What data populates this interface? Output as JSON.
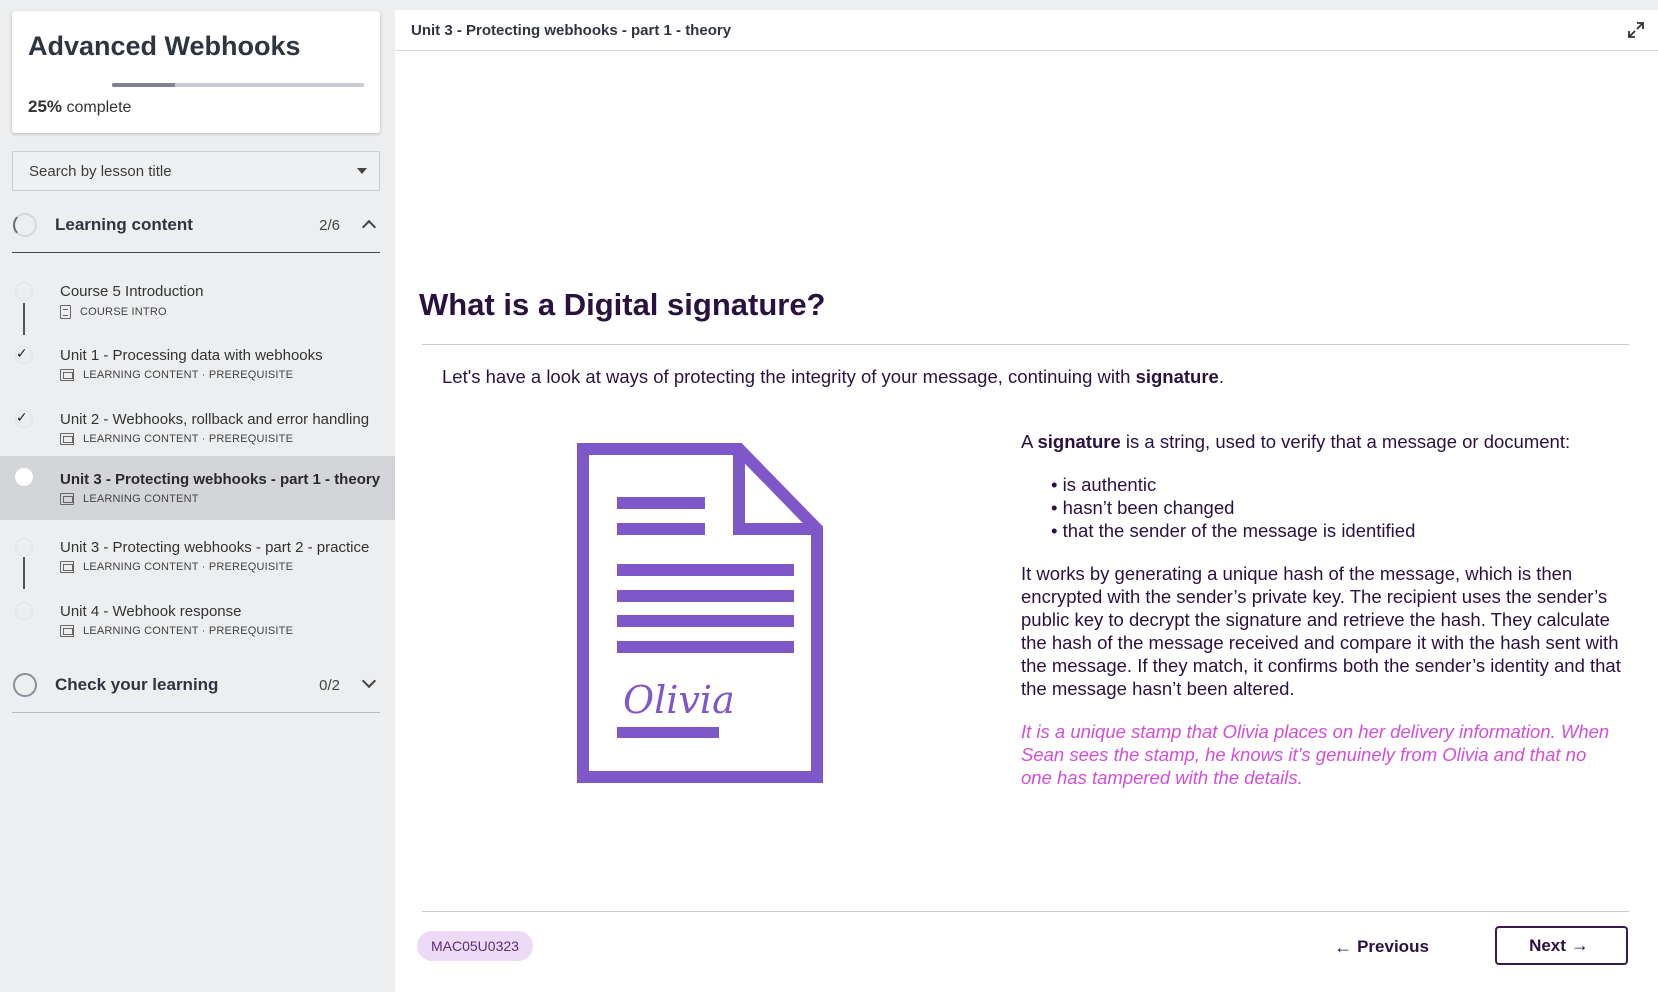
{
  "course": {
    "title": "Advanced Webhooks",
    "progress_percent": 25,
    "progress_pct_label": "25%",
    "progress_suffix": "complete"
  },
  "search": {
    "placeholder": "Search by lesson title"
  },
  "sections": [
    {
      "label": "Learning content",
      "count": "2/6",
      "expanded": true
    },
    {
      "label": "Check your learning",
      "count": "0/2",
      "expanded": false
    }
  ],
  "lessons": [
    {
      "title": "Course 5 Introduction",
      "meta": "COURSE INTRO",
      "completed": false,
      "active": false,
      "icon": "document-icon"
    },
    {
      "title": "Unit 1 - Processing data with webhooks",
      "meta": "LEARNING CONTENT · PREREQUISITE",
      "completed": true,
      "active": false,
      "icon": "slides-icon"
    },
    {
      "title": "Unit 2 - Webhooks, rollback and error handling",
      "meta": "LEARNING CONTENT · PREREQUISITE",
      "completed": true,
      "active": false,
      "icon": "slides-icon"
    },
    {
      "title": "Unit 3 - Protecting webhooks - part 1 - theory",
      "meta": "LEARNING CONTENT",
      "completed": false,
      "active": true,
      "icon": "slides-icon"
    },
    {
      "title": "Unit 3 - Protecting webhooks - part 2 - practice",
      "meta": "LEARNING CONTENT · PREREQUISITE",
      "completed": false,
      "active": false,
      "icon": "slides-icon"
    },
    {
      "title": "Unit 4 - Webhook response",
      "meta": "LEARNING CONTENT · PREREQUISITE",
      "completed": false,
      "active": false,
      "icon": "slides-icon"
    }
  ],
  "main": {
    "breadcrumb": "Unit 3 - Protecting webhooks - part 1 - theory",
    "heading": "What is a Digital signature?",
    "intro_prefix": "Let's have a look at ways of protecting the integrity of your message, continuing with ",
    "intro_bold": "signature",
    "intro_suffix": ".",
    "illustration_signature": "Olivia",
    "def_prefix": "A ",
    "def_bold": "signature",
    "def_suffix": " is a string, used to verify that a message or document:",
    "bullets": [
      "is authentic",
      "hasn’t been changed",
      "that the sender of the message is identified"
    ],
    "explanation": "It works by generating a unique hash of the message, which is then encrypted with the sender’s private key. The recipient uses the sender’s public key to decrypt the signature and retrieve the hash. They calculate the hash of the message received and compare it with the hash sent with the message. If they match, it confirms both the sender’s identity and that the message hasn’t been altered.",
    "analogy": "It is a unique stamp that Olivia places on her delivery information. When Sean sees the stamp, he knows it’s genuinely from Olivia and that no one has tampered with the details."
  },
  "footer": {
    "code": "MAC05U0323",
    "prev_label": "Previous",
    "next_label": "Next"
  },
  "colors": {
    "accent_purple": "#7e57c8",
    "heading": "#2a1240",
    "analogy_pink": "#d14fd8",
    "chip_bg": "#ecdaf6"
  }
}
